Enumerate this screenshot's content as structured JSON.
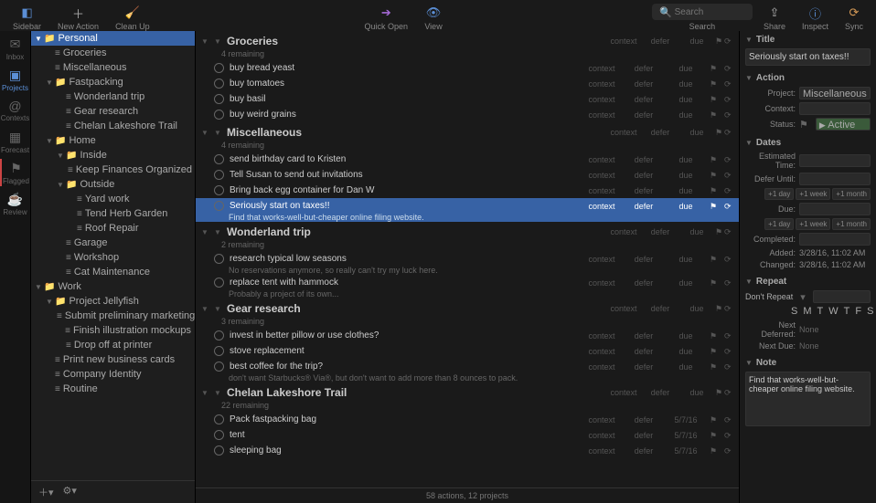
{
  "toolbar": {
    "sidebar": "Sidebar",
    "new_action": "New Action",
    "clean_up": "Clean Up",
    "quick_open": "Quick Open",
    "view": "View",
    "search": "Search",
    "search_placeholder": "Search",
    "share": "Share",
    "inspect": "Inspect",
    "sync": "Sync"
  },
  "nav": [
    {
      "label": "Inbox",
      "icon": "✉"
    },
    {
      "label": "Projects",
      "icon": "▣"
    },
    {
      "label": "Contexts",
      "icon": "@"
    },
    {
      "label": "Forecast",
      "icon": "▦"
    },
    {
      "label": "Flagged",
      "icon": "⚑"
    },
    {
      "label": "Review",
      "icon": "☕"
    }
  ],
  "sidebar_tree": [
    {
      "d": 0,
      "t": "folder",
      "label": "Personal",
      "sel": true
    },
    {
      "d": 1,
      "t": "proj",
      "label": "Groceries"
    },
    {
      "d": 1,
      "t": "proj",
      "label": "Miscellaneous"
    },
    {
      "d": 1,
      "t": "folder",
      "label": "Fastpacking"
    },
    {
      "d": 2,
      "t": "proj",
      "label": "Wonderland trip"
    },
    {
      "d": 2,
      "t": "proj",
      "label": "Gear research"
    },
    {
      "d": 2,
      "t": "proj",
      "label": "Chelan Lakeshore Trail"
    },
    {
      "d": 1,
      "t": "folder",
      "label": "Home"
    },
    {
      "d": 2,
      "t": "folder",
      "label": "Inside"
    },
    {
      "d": 3,
      "t": "proj",
      "label": "Keep Finances Organized"
    },
    {
      "d": 2,
      "t": "folder",
      "label": "Outside"
    },
    {
      "d": 3,
      "t": "proj",
      "label": "Yard work"
    },
    {
      "d": 3,
      "t": "proj",
      "label": "Tend Herb Garden"
    },
    {
      "d": 3,
      "t": "proj",
      "label": "Roof Repair"
    },
    {
      "d": 2,
      "t": "proj",
      "label": "Garage"
    },
    {
      "d": 2,
      "t": "proj",
      "label": "Workshop"
    },
    {
      "d": 2,
      "t": "proj",
      "label": "Cat Maintenance"
    },
    {
      "d": 0,
      "t": "folder",
      "label": "Work"
    },
    {
      "d": 1,
      "t": "folder",
      "label": "Project Jellyfish"
    },
    {
      "d": 2,
      "t": "proj",
      "label": "Submit preliminary marketing..."
    },
    {
      "d": 2,
      "t": "proj",
      "label": "Finish illustration mockups"
    },
    {
      "d": 2,
      "t": "proj",
      "label": "Drop off at printer"
    },
    {
      "d": 1,
      "t": "proj",
      "label": "Print new business cards"
    },
    {
      "d": 1,
      "t": "proj",
      "label": "Company Identity"
    },
    {
      "d": 1,
      "t": "proj",
      "label": "Routine"
    }
  ],
  "content_groups": [
    {
      "title": "Groceries",
      "sub": "4 remaining",
      "context": "context",
      "defer": "defer",
      "due": "due",
      "tasks": [
        {
          "title": "buy bread yeast",
          "context": "context",
          "defer": "defer",
          "due": "due"
        },
        {
          "title": "buy tomatoes",
          "context": "context",
          "defer": "defer",
          "due": "due"
        },
        {
          "title": "buy basil",
          "context": "context",
          "defer": "defer",
          "due": "due"
        },
        {
          "title": "buy weird grains",
          "context": "context",
          "defer": "defer",
          "due": "due"
        }
      ]
    },
    {
      "title": "Miscellaneous",
      "sub": "4 remaining",
      "context": "context",
      "defer": "defer",
      "due": "due",
      "tasks": [
        {
          "title": "send birthday card to Kristen",
          "context": "context",
          "defer": "defer",
          "due": "due"
        },
        {
          "title": "Tell Susan to send out invitations",
          "context": "context",
          "defer": "defer",
          "due": "due"
        },
        {
          "title": "Bring back egg container for Dan W",
          "context": "context",
          "defer": "defer",
          "due": "due"
        },
        {
          "title": "Seriously start on taxes!!",
          "note": "Find that works-well-but-cheaper online filing website.",
          "context": "context",
          "defer": "defer",
          "due": "due",
          "sel": true
        }
      ]
    },
    {
      "title": "Wonderland trip",
      "sub": "2 remaining",
      "context": "context",
      "defer": "defer",
      "due": "due",
      "tasks": [
        {
          "title": "research typical low seasons",
          "note": "No reservations anymore, so really can't try my luck here.",
          "context": "context",
          "defer": "defer",
          "due": "due"
        },
        {
          "title": "replace tent with hammock",
          "note": "Probably a project of its own...",
          "context": "context",
          "defer": "defer",
          "due": "due"
        }
      ]
    },
    {
      "title": "Gear research",
      "sub": "3 remaining",
      "context": "context",
      "defer": "defer",
      "due": "due",
      "tasks": [
        {
          "title": "invest in better pillow or use clothes?",
          "context": "context",
          "defer": "defer",
          "due": "due"
        },
        {
          "title": "stove replacement",
          "context": "context",
          "defer": "defer",
          "due": "due"
        },
        {
          "title": "best coffee for the trip?",
          "note": "don't want Starbucks® Via®, but don't want to add more than 8 ounces to pack.",
          "context": "context",
          "defer": "defer",
          "due": "due"
        }
      ]
    },
    {
      "title": "Chelan Lakeshore Trail",
      "sub": "22 remaining",
      "context": "context",
      "defer": "defer",
      "due": "due",
      "tasks": [
        {
          "title": "Pack fastpacking bag",
          "context": "context",
          "defer": "defer",
          "due": "5/7/16"
        },
        {
          "title": "tent",
          "context": "context",
          "defer": "defer",
          "due": "5/7/16"
        },
        {
          "title": "sleeping bag",
          "context": "context",
          "defer": "defer",
          "due": "5/7/16"
        }
      ]
    }
  ],
  "status_bar": "58 actions, 12 projects",
  "inspector": {
    "title_section": "Title",
    "title_value": "Seriously start on taxes!!",
    "action_section": "Action",
    "project_label": "Project:",
    "project_value": "Miscellaneous",
    "context_label": "Context:",
    "context_value": "",
    "status_label": "Status:",
    "status_active": "Active",
    "dates_section": "Dates",
    "est_time_label": "Estimated Time:",
    "defer_label": "Defer Until:",
    "due_label": "Due:",
    "completed_label": "Completed:",
    "quick_1day": "+1 day",
    "quick_1week": "+1 week",
    "quick_1month": "+1 month",
    "added_label": "Added:",
    "added_value": "3/28/16, 11:02 AM",
    "changed_label": "Changed:",
    "changed_value": "3/28/16, 11:02 AM",
    "repeat_section": "Repeat",
    "repeat_value": "Don't Repeat",
    "days": [
      "S",
      "M",
      "T",
      "W",
      "T",
      "F",
      "S"
    ],
    "next_deferred_label": "Next Deferred:",
    "next_deferred_value": "None",
    "next_due_label": "Next Due:",
    "next_due_value": "None",
    "note_section": "Note",
    "note_value": "Find that works-well-but-cheaper online filing website."
  }
}
